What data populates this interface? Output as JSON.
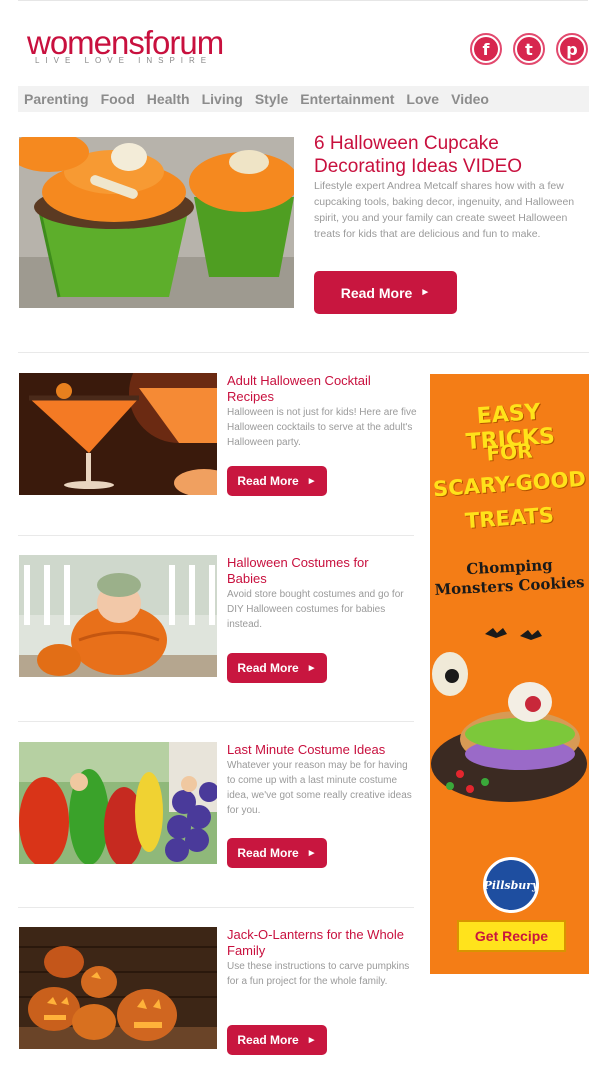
{
  "brand": {
    "logo_text": "womensforum",
    "tagline": "LIVE  LOVE  INSPIRE",
    "accent": "#c8103e"
  },
  "social": [
    {
      "name": "facebook-icon",
      "glyph": "f"
    },
    {
      "name": "twitter-icon",
      "glyph": "t"
    },
    {
      "name": "pinterest-icon",
      "glyph": "p"
    }
  ],
  "nav": [
    "Parenting",
    "Food",
    "Health",
    "Living",
    "Style",
    "Entertainment",
    "Love",
    "Video"
  ],
  "hero": {
    "title": "6 Halloween Cupcake Decorating Ideas VIDEO",
    "description": "Lifestyle expert Andrea Metcalf shares how with a few cupcaking tools, baking decor, ingenuity, and Halloween spirit, you and your family can create sweet Halloween treats for kids that are delicious and fun to make.",
    "button": "Read More"
  },
  "articles": [
    {
      "title": "Adult Halloween Cocktail Recipes",
      "description": "Halloween is not just for kids! Here are five Halloween cocktails to serve at the adult's Halloween party.",
      "button": "Read More"
    },
    {
      "title": "Halloween Costumes for Babies",
      "description": "Avoid store bought costumes and go for DIY Halloween costumes for babies instead.",
      "button": "Read More"
    },
    {
      "title": "Last Minute Costume Ideas",
      "description": "Whatever your reason may be for having to come up with a last minute costume idea, we've got some really creative ideas for you.",
      "button": "Read More"
    },
    {
      "title": "Jack-O-Lanterns for the Whole Family",
      "description": "Use these instructions to carve pumpkins for a fun project for the whole family.",
      "button": "Read More"
    }
  ],
  "ad": {
    "line1": "EASY TRICKS",
    "line2": "FOR",
    "line3": "SCARY-GOOD",
    "line4": "TREATS",
    "product_line1": "Chomping",
    "product_line2": "Monsters Cookies",
    "brand": "Pillsbury",
    "button": "Get Recipe"
  }
}
